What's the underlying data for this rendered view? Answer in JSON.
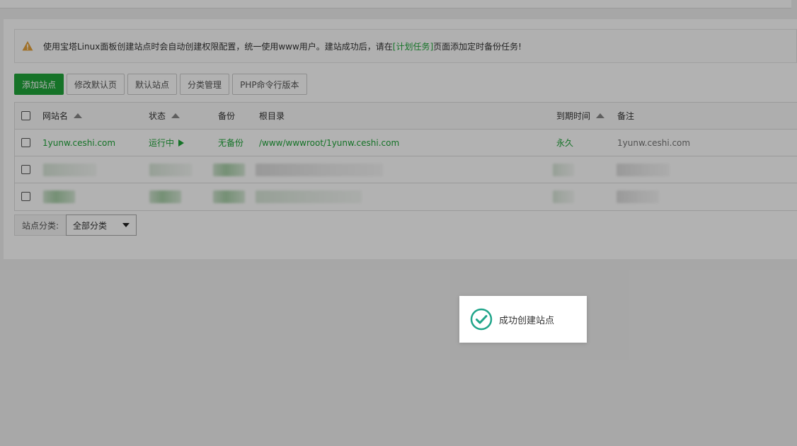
{
  "notice": {
    "text_before": "使用宝塔Linux面板创建站点时会自动创建权限配置，统一使用www用户。建站成功后，请在",
    "link": "[计划任务]",
    "text_after": "页面添加定时备份任务!"
  },
  "toolbar": {
    "add_site": "添加站点",
    "edit_default_page": "修改默认页",
    "default_site": "默认站点",
    "category_manage": "分类管理",
    "php_cli_version": "PHP命令行版本"
  },
  "table": {
    "headers": {
      "name": "网站名",
      "status": "状态",
      "backup": "备份",
      "root": "根目录",
      "expire": "到期时间",
      "remark": "备注"
    },
    "rows": [
      {
        "name": "1yunw.ceshi.com",
        "status": "运行中",
        "status_icon": "play-icon",
        "backup": "无备份",
        "root": "/www/wwwroot/1yunw.ceshi.com",
        "expire": "永久",
        "remark": "1yunw.ceshi.com"
      }
    ]
  },
  "filter": {
    "label": "站点分类:",
    "selected": "全部分类"
  },
  "toast": {
    "message": "成功创建站点",
    "icon": "check-circle-icon"
  },
  "colors": {
    "brand": "#20a53a",
    "warning": "#e6a23c",
    "toast_icon": "#20a58a"
  }
}
